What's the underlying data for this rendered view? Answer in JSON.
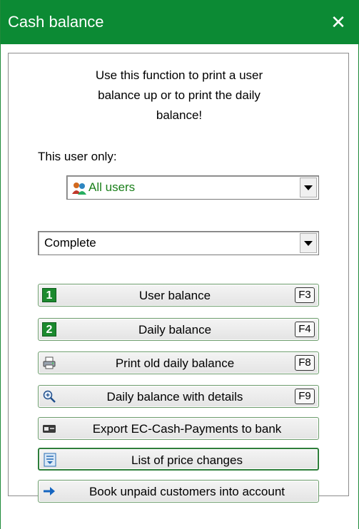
{
  "window": {
    "title": "Cash balance",
    "close_glyph": "✕"
  },
  "description": "Use this function to print a user\nbalance up or to print the daily\nbalance!",
  "user_filter": {
    "label": "This user only:",
    "selected": "All users",
    "icon": "users-icon",
    "text_color": "#1a7f1a"
  },
  "mode_select": {
    "selected": "Complete"
  },
  "buttons": [
    {
      "label": "User balance",
      "key": "F3",
      "icon": "number-1-icon",
      "icon_text": "1"
    },
    {
      "label": "Daily balance",
      "key": "F4",
      "icon": "number-2-icon",
      "icon_text": "2"
    },
    {
      "label": "Print old daily balance",
      "key": "F8",
      "icon": "printer-icon"
    },
    {
      "label": "Daily balance with details",
      "key": "F9",
      "icon": "magnifier-icon"
    },
    {
      "label": "Export EC-Cash-Payments to bank",
      "icon": "card-icon"
    },
    {
      "label": "List of price changes",
      "icon": "list-icon"
    },
    {
      "label": "Book unpaid customers into account",
      "icon": "arrow-right-icon"
    }
  ],
  "colors": {
    "titlebar": "#0c8a34",
    "accent_green": "#1b8a2e",
    "arrow_blue": "#1565c0"
  }
}
